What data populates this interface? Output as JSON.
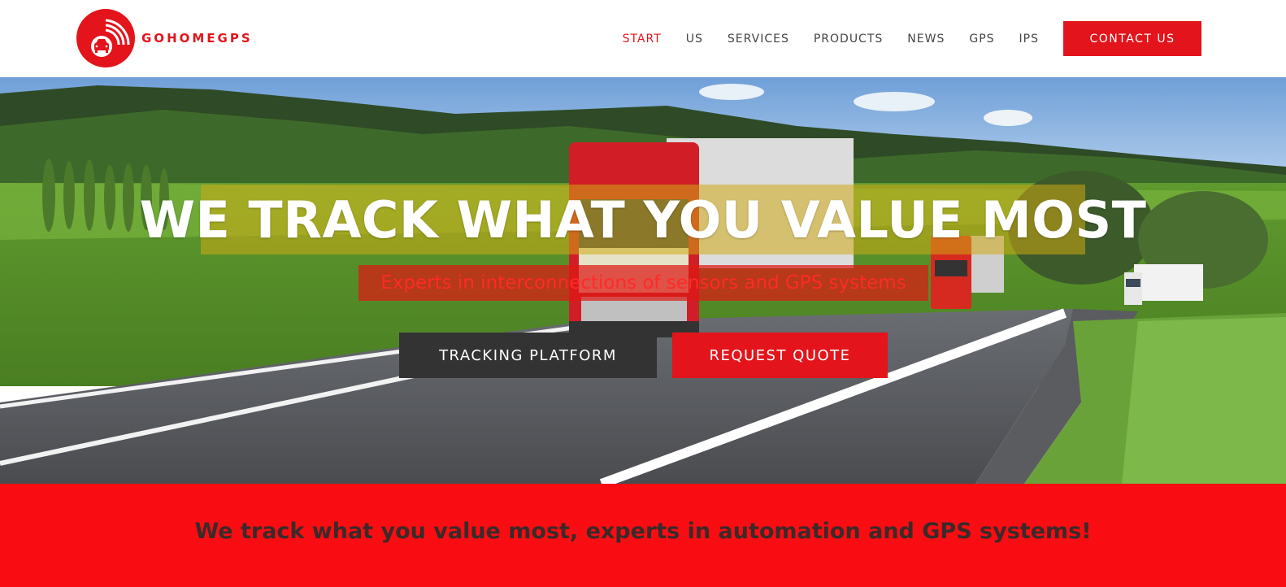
{
  "brand": {
    "name": "GOHOMEGPS",
    "color": "#e3141b"
  },
  "nav": {
    "items": [
      {
        "label": "START",
        "active": true
      },
      {
        "label": "US"
      },
      {
        "label": "SERVICES"
      },
      {
        "label": "PRODUCTS"
      },
      {
        "label": "NEWS"
      },
      {
        "label": "GPS"
      },
      {
        "label": "IPS"
      }
    ],
    "contact_label": "CONTACT US"
  },
  "hero": {
    "title": "WE TRACK WHAT YOU VALUE MOST",
    "subtitle": "Experts in interconnections of sensors and GPS systems",
    "buttons": {
      "tracking": "TRACKING PLATFORM",
      "quote": "REQUEST QUOTE"
    },
    "background_icon": "truck-road-landscape-photo"
  },
  "banner": {
    "text": "We track what you value most, experts in automation and GPS systems!",
    "color": "#fa0d12"
  }
}
